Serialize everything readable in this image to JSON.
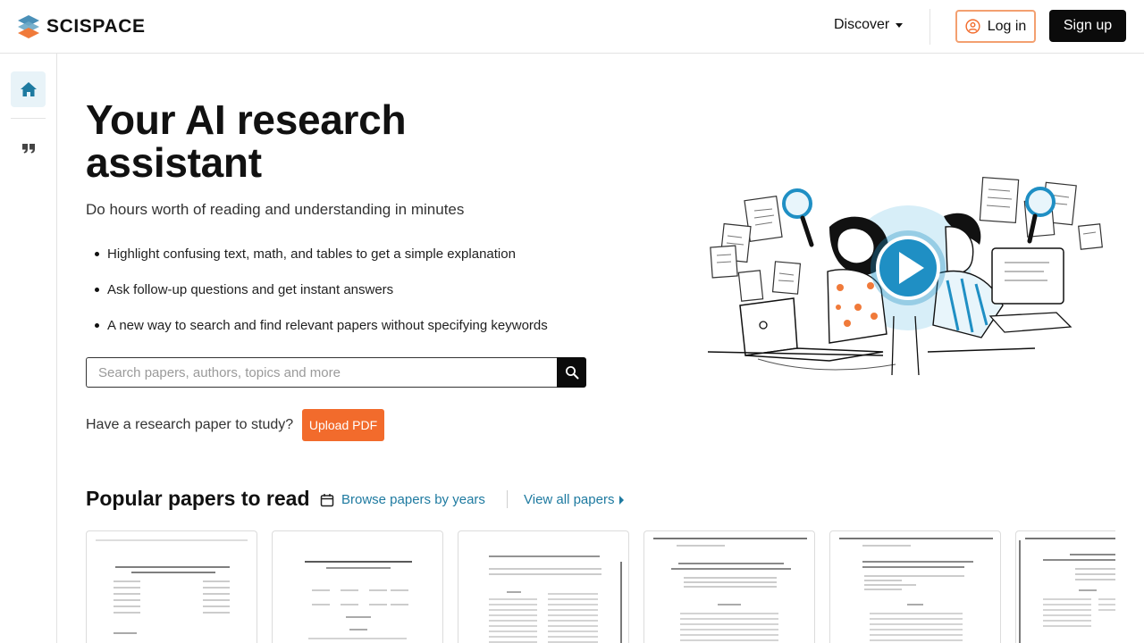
{
  "header": {
    "logo_text": "SCISPACE",
    "discover_label": "Discover",
    "login_label": "Log in",
    "signup_label": "Sign up"
  },
  "sidebar": {
    "items": [
      {
        "icon": "home-icon",
        "active": true
      },
      {
        "icon": "quote-icon",
        "active": false
      }
    ]
  },
  "hero": {
    "title": "Your AI research assistant",
    "subtitle": "Do hours worth of reading and understanding in minutes",
    "bullets": [
      "Highlight confusing text, math, and tables to get a simple explanation",
      "Ask follow-up questions and get instant answers",
      "A new way to search and find relevant papers without specifying keywords"
    ],
    "search": {
      "placeholder": "Search papers, authors, topics and more",
      "value": ""
    },
    "upload_prompt": "Have a research paper to study?",
    "upload_label": "Upload PDF"
  },
  "popular": {
    "title": "Popular papers to read",
    "browse_label": "Browse papers by years",
    "view_all_label": "View all papers",
    "paper_count_visible": 6
  },
  "colors": {
    "brand_orange": "#f26b2c",
    "link_blue": "#1e7aa0",
    "illustration_blue": "#1f8fc4",
    "login_border": "#f3a070",
    "dark": "#0b0b0b"
  }
}
